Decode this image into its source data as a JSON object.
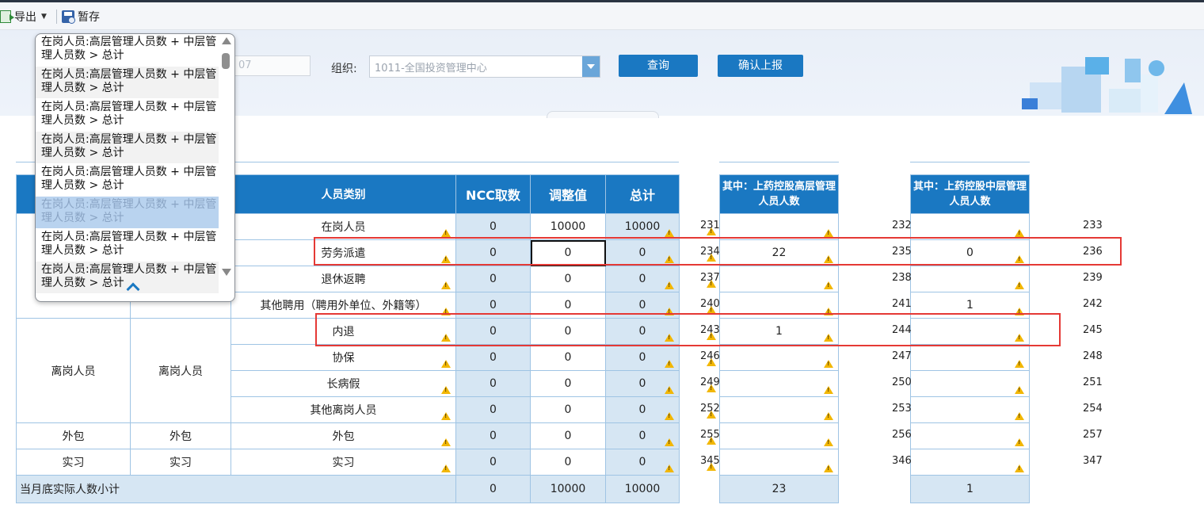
{
  "toolbar": {
    "export_label": "导出",
    "save_label": "暂存"
  },
  "filter": {
    "date_value": "07",
    "org_label": "组织:",
    "org_value": "1011-全国投资管理中心",
    "query_label": "查询",
    "confirm_label": "确认上报"
  },
  "table": {
    "headers": {
      "category": "人员类别",
      "ncc": "NCC取数",
      "adjust": "调整值",
      "total": "总计",
      "senior": "其中：上药控股高层管理人员人数",
      "middle": "其中：上药控股中层管理人员人数"
    },
    "group_offpost": "离岗人员",
    "sub_offpost": "离岗人员",
    "rows": [
      {
        "g1": "",
        "g2": "",
        "label": "在岗人员",
        "ncc": "0",
        "adj": "10000",
        "tot": "10000",
        "c1": "231",
        "senior": "",
        "c2": "232",
        "middle": "",
        "c3": "233"
      },
      {
        "g1": "",
        "g2": "",
        "label": "劳务派遣",
        "ncc": "0",
        "adj": "0",
        "tot": "0",
        "c1": "234",
        "senior": "22",
        "c2": "235",
        "middle": "0",
        "c3": "236"
      },
      {
        "g1": "",
        "g2": "",
        "label": "退休返聘",
        "ncc": "0",
        "adj": "0",
        "tot": "0",
        "c1": "237",
        "senior": "",
        "c2": "238",
        "middle": "",
        "c3": "239"
      },
      {
        "g1": "",
        "g2": "",
        "label": "其他聘用（聘用外单位、外籍等）",
        "ncc": "0",
        "adj": "0",
        "tot": "0",
        "c1": "240",
        "senior": "",
        "c2": "241",
        "middle": "1",
        "c3": "242"
      },
      {
        "g1": "",
        "g2": "",
        "label": "内退",
        "ncc": "0",
        "adj": "0",
        "tot": "0",
        "c1": "243",
        "senior": "1",
        "c2": "244",
        "middle": "",
        "c3": "245"
      },
      {
        "g1": "",
        "g2": "",
        "label": "协保",
        "ncc": "0",
        "adj": "0",
        "tot": "0",
        "c1": "246",
        "senior": "",
        "c2": "247",
        "middle": "",
        "c3": "248"
      },
      {
        "g1": "",
        "g2": "",
        "label": "长病假",
        "ncc": "0",
        "adj": "0",
        "tot": "0",
        "c1": "249",
        "senior": "",
        "c2": "250",
        "middle": "",
        "c3": "251"
      },
      {
        "g1": "",
        "g2": "",
        "label": "其他离岗人员",
        "ncc": "0",
        "adj": "0",
        "tot": "0",
        "c1": "252",
        "senior": "",
        "c2": "253",
        "middle": "",
        "c3": "254"
      },
      {
        "g1": "外包",
        "g2": "外包",
        "label": "外包",
        "ncc": "0",
        "adj": "0",
        "tot": "0",
        "c1": "255",
        "senior": "",
        "c2": "256",
        "middle": "",
        "c3": "257"
      },
      {
        "g1": "实习",
        "g2": "实习",
        "label": "实习",
        "ncc": "0",
        "adj": "0",
        "tot": "0",
        "c1": "345",
        "senior": "",
        "c2": "346",
        "middle": "",
        "c3": "347"
      }
    ],
    "subtotal": {
      "label": "当月底实际人数小计",
      "ncc": "0",
      "adj": "10000",
      "tot": "10000",
      "senior": "23",
      "middle": "1"
    }
  },
  "popup": {
    "items": [
      "在岗人员:高层管理人员数 + 中层管理人员数 > 总计",
      "在岗人员:高层管理人员数 + 中层管理人员数 > 总计",
      "在岗人员:高层管理人员数 + 中层管理人员数 > 总计",
      "在岗人员:高层管理人员数 + 中层管理人员数 > 总计",
      "在岗人员:高层管理人员数 + 中层管理人员数 > 总计",
      "在岗人员:高层管理人员数 + 中层管理人员数 > 总计",
      "在岗人员:高层管理人员数 + 中层管理人员数 > 总计",
      "在岗人员:高层管理人员数 + 中层管理人员数 > 总计"
    ]
  },
  "colors": {
    "header_blue": "#1a78c2",
    "cell_blue": "#d6e6f3",
    "grid_line": "#9fc4e4",
    "warn_yellow": "#f2b705",
    "highlight_red": "#e53935"
  }
}
